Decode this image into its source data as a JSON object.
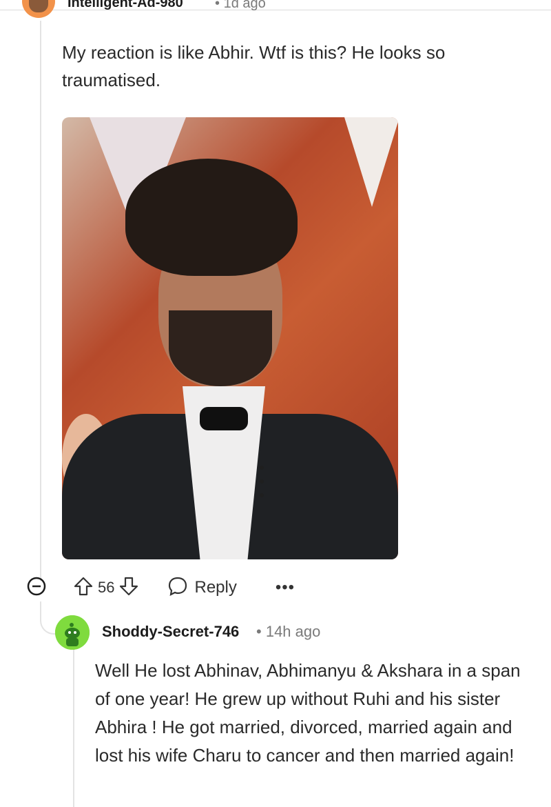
{
  "comments": [
    {
      "username": "Intelligent-Ad-980",
      "time": "1d ago",
      "body": "My reaction is like Abhir. Wtf is this? He looks so traumatised.",
      "votes": "56",
      "reply_label": "Reply",
      "more_label": "•••"
    },
    {
      "username": "Shoddy-Secret-746",
      "time": "14h ago",
      "body": "Well He lost Abhinav, Abhimanyu & Akshara in a span of one year! He grew up without Ruhi and his sister Abhira ! He got married, divorced, married again and lost his wife Charu to cancer and then married again!"
    }
  ],
  "separator": "•",
  "colors": {
    "avatar_top": "#f2924a",
    "avatar_bottom": "#7fdb3e",
    "text": "#1c1c1c",
    "muted": "#7a7a7a"
  },
  "icons": [
    "collapse-icon",
    "upvote-icon",
    "downvote-icon",
    "reply-bubble-icon",
    "more-options-icon",
    "avatar-icon"
  ]
}
